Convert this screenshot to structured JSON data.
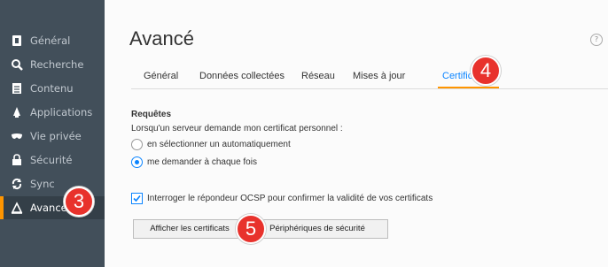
{
  "sidebar": {
    "items": [
      {
        "label": "Général",
        "icon": "general-icon"
      },
      {
        "label": "Recherche",
        "icon": "search-icon"
      },
      {
        "label": "Contenu",
        "icon": "content-icon"
      },
      {
        "label": "Applications",
        "icon": "applications-icon"
      },
      {
        "label": "Vie privée",
        "icon": "privacy-mask-icon"
      },
      {
        "label": "Sécurité",
        "icon": "lock-icon"
      },
      {
        "label": "Sync",
        "icon": "sync-icon"
      },
      {
        "label": "Avancé",
        "icon": "advanced-icon"
      }
    ],
    "active_index": 7
  },
  "main": {
    "title": "Avancé",
    "help_symbol": "?",
    "tabs": [
      {
        "label": "Général"
      },
      {
        "label": "Données collectées"
      },
      {
        "label": "Réseau"
      },
      {
        "label": "Mises à jour"
      },
      {
        "label": "Certificats"
      }
    ],
    "selected_tab": "Certificats"
  },
  "requests": {
    "heading": "Requêtes",
    "description": "Lorsqu'un serveur demande mon certificat personnel :",
    "option_auto": "en sélectionner un automatiquement",
    "option_ask": "me demander à chaque fois",
    "ocsp_label": "Interroger le répondeur OCSP pour confirmer la validité de vos certificats"
  },
  "buttons": {
    "show_certs": "Afficher les certificats",
    "security_devices": "Périphériques de sécurité"
  },
  "annotations": {
    "badge_3": "3",
    "badge_4": "4",
    "badge_5": "5"
  },
  "colors": {
    "accent": "#0a84ff",
    "active_indicator": "#ff9500",
    "badge": "#e8322c",
    "sidebar_bg": "#424f5a"
  }
}
